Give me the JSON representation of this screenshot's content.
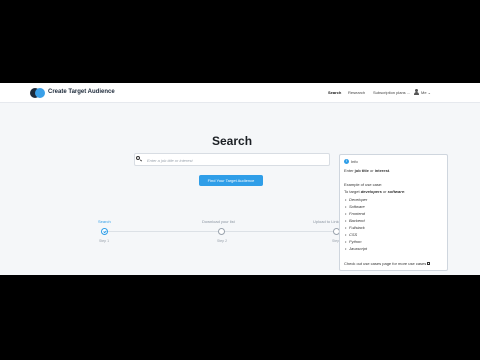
{
  "header": {
    "brand": "Create Target Audience",
    "nav": [
      "Search",
      "Research",
      "Subscription plans ..."
    ],
    "user": "Me"
  },
  "main": {
    "title": "Search",
    "search_placeholder": "Enter a job title or interest",
    "cta_label": "Find Your Target Audience"
  },
  "steps": [
    {
      "label": "Search",
      "num": "Step 1",
      "active": true
    },
    {
      "label": "Download your list",
      "num": "Step 2",
      "active": false
    },
    {
      "label": "Upload to LinkedIn",
      "num": "Step 3",
      "active": false
    }
  ],
  "info": {
    "title": "Info",
    "intro_prefix": "Enter ",
    "intro_b1": "job title",
    "intro_mid": " or ",
    "intro_b2": "interest",
    "intro_end": ".",
    "example": "Example of use case:",
    "target_prefix": "To target ",
    "target_b1": "developers",
    "target_mid": " or ",
    "target_b2": "software",
    "target_end": ":",
    "items": [
      "Developer",
      "Software",
      "Frontend",
      "Backend",
      "Fullstack",
      "CSS",
      "Python",
      "Javascript"
    ],
    "footer": "Check out use cases page for more use cases"
  },
  "colors": {
    "accent": "#2f9ee8",
    "brand_dark": "#1d2a3a"
  }
}
